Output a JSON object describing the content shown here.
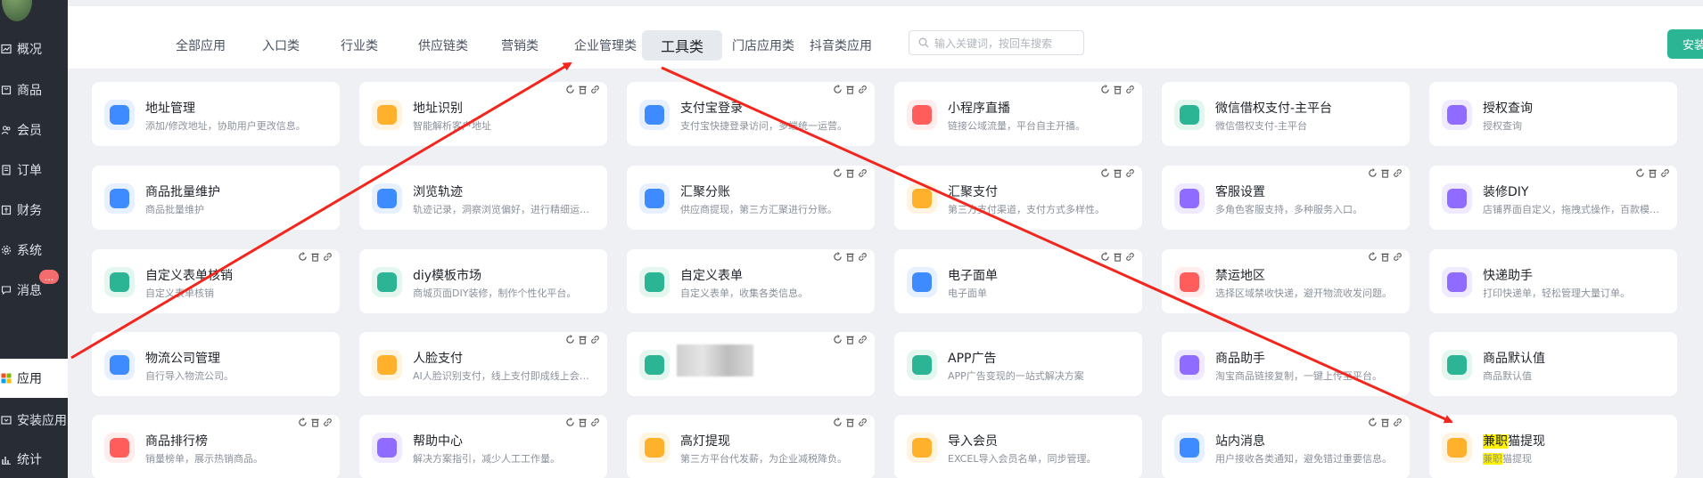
{
  "sidebar": {
    "items": [
      {
        "label": "概况",
        "icon": "chart-icon"
      },
      {
        "label": "商品",
        "icon": "goods-icon"
      },
      {
        "label": "会员",
        "icon": "users-icon"
      },
      {
        "label": "订单",
        "icon": "order-icon"
      },
      {
        "label": "财务",
        "icon": "finance-icon"
      },
      {
        "label": "系统",
        "icon": "gear-icon"
      },
      {
        "label": "消息",
        "icon": "message-icon"
      },
      {
        "label": "应用",
        "icon": "apps-icon"
      },
      {
        "label": "安装应用",
        "icon": "install-icon"
      },
      {
        "label": "统计",
        "icon": "stats-icon"
      }
    ],
    "badge": "...",
    "active": "应用"
  },
  "topbar": {
    "tabs": [
      "全部应用",
      "入口类",
      "行业类",
      "供应链类",
      "营销类",
      "企业管理类",
      "工具类",
      "门店应用类",
      "抖音类应用"
    ],
    "active_tab": "工具类",
    "search_placeholder": "输入关键词，按回车搜索",
    "install_button": "安装应用"
  },
  "cards": [
    {
      "title": "地址管理",
      "desc": "添加/修改地址，协助用户更改信息。",
      "color": "#3d8bff",
      "bg": "#e7f0ff",
      "tools": false
    },
    {
      "title": "地址识别",
      "desc": "智能解析客户地址",
      "color": "#ffb12b",
      "bg": "#fff4e0",
      "tools": true
    },
    {
      "title": "支付宝登录",
      "desc": "支付宝快捷登录访问，多端统一运营。",
      "color": "#3d8bff",
      "bg": "#e7f0ff",
      "tools": true
    },
    {
      "title": "小程序直播",
      "desc": "链接公域流量，平台自主开播。",
      "color": "#ff5c5c",
      "bg": "#ffecec",
      "tools": true
    },
    {
      "title": "微信借权支付-主平台",
      "desc": "微信借权支付-主平台",
      "color": "#2bb594",
      "bg": "#e3f7ef",
      "tools": false
    },
    {
      "title": "授权查询",
      "desc": "授权查询",
      "color": "#8f6bff",
      "bg": "#efeaff",
      "tools": false
    },
    {
      "title": "商品批量维护",
      "desc": "商品批量维护",
      "color": "#3d8bff",
      "bg": "#e7f0ff",
      "tools": false
    },
    {
      "title": "浏览轨迹",
      "desc": "轨迹记录，洞察浏览偏好，进行精细运营。",
      "color": "#3d8bff",
      "bg": "#e7f0ff",
      "tools": false
    },
    {
      "title": "汇聚分账",
      "desc": "供应商提现，第三方汇聚进行分账。",
      "color": "#3d8bff",
      "bg": "#e7f0ff",
      "tools": true
    },
    {
      "title": "汇聚支付",
      "desc": "第三方支付渠道，支付方式多样性。",
      "color": "#ffb12b",
      "bg": "#fff4e0",
      "tools": true
    },
    {
      "title": "客服设置",
      "desc": "多角色客服支持，多种服务入口。",
      "color": "#8f6bff",
      "bg": "#efeaff",
      "tools": true
    },
    {
      "title": "装修DIY",
      "desc": "店铺界面自定义，拖拽式操作，百款模版...",
      "color": "#8f6bff",
      "bg": "#efeaff",
      "tools": true
    },
    {
      "title": "自定义表单核销",
      "desc": "自定义表单核销",
      "color": "#2bb594",
      "bg": "#e3f7ef",
      "tools": true
    },
    {
      "title": "diy模板市场",
      "desc": "商城页面DIY装修，制作个性化平台。",
      "color": "#2bb594",
      "bg": "#e3f7ef",
      "tools": false
    },
    {
      "title": "自定义表单",
      "desc": "自定义表单，收集各类信息。",
      "color": "#2bb594",
      "bg": "#e3f7ef",
      "tools": true
    },
    {
      "title": "电子面单",
      "desc": "电子面单",
      "color": "#3d8bff",
      "bg": "#e7f0ff",
      "tools": true
    },
    {
      "title": "禁运地区",
      "desc": "选择区域禁收快递，避开物流收发问题。",
      "color": "#ff5c5c",
      "bg": "#ffecec",
      "tools": true
    },
    {
      "title": "快递助手",
      "desc": "打印快递单，轻松管理大量订单。",
      "color": "#8f6bff",
      "bg": "#efeaff",
      "tools": false
    },
    {
      "title": "物流公司管理",
      "desc": "自行导入物流公司。",
      "color": "#3d8bff",
      "bg": "#e7f0ff",
      "tools": false
    },
    {
      "title": "人脸支付",
      "desc": "AI人脸识别支付，线上支付即成线上会员。",
      "color": "#ffb12b",
      "bg": "#fff4e0",
      "tools": true
    },
    {
      "title": "",
      "desc": "",
      "color": "#2bb594",
      "bg": "#e3f7ef",
      "tools": true,
      "blurred": true
    },
    {
      "title": "APP广告",
      "desc": "APP广告变现的一站式解决方案",
      "color": "#2bb594",
      "bg": "#e3f7ef",
      "tools": false
    },
    {
      "title": "商品助手",
      "desc": "淘宝商品链接复制，一键上传至平台。",
      "color": "#8f6bff",
      "bg": "#efeaff",
      "tools": false
    },
    {
      "title": "商品默认值",
      "desc": "商品默认值",
      "color": "#2bb594",
      "bg": "#e3f7ef",
      "tools": false
    },
    {
      "title": "商品排行榜",
      "desc": "销量榜单，展示热销商品。",
      "color": "#ff5c5c",
      "bg": "#ffecec",
      "tools": true
    },
    {
      "title": "帮助中心",
      "desc": "解决方案指引，减少人工工作量。",
      "color": "#8f6bff",
      "bg": "#efeaff",
      "tools": true
    },
    {
      "title": "高灯提现",
      "desc": "第三方平台代发薪，为企业减税降负。",
      "color": "#ffb12b",
      "bg": "#fff4e0",
      "tools": true
    },
    {
      "title": "导入会员",
      "desc": "EXCEL导入会员名单，同步管理。",
      "color": "#ffb12b",
      "bg": "#fff4e0",
      "tools": false
    },
    {
      "title": "站内消息",
      "desc": "用户接收各类通知，避免错过重要信息。",
      "color": "#3d8bff",
      "bg": "#e7f0ff",
      "tools": true
    },
    {
      "title": "兼职猫提现",
      "desc": "兼职猫提现",
      "color": "#ffb12b",
      "bg": "#fff4e0",
      "tools": false,
      "highlight": "兼职"
    }
  ],
  "colors": {
    "accent": "#2bb594",
    "sidebar_bg": "#282c34",
    "arrow": "#f2261d"
  }
}
